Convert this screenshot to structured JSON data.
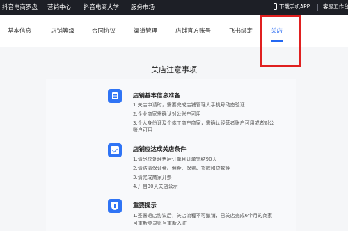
{
  "topbar": {
    "nav": [
      "抖音电商罗盘",
      "营销中心",
      "抖音电商大学",
      "服务市场"
    ],
    "download_app": "下载手机APP",
    "service_center": "客服工作台"
  },
  "tabs": [
    {
      "label": "基本信息",
      "active": false
    },
    {
      "label": "店铺等级",
      "active": false
    },
    {
      "label": "合同协议",
      "active": false
    },
    {
      "label": "渠道管理",
      "active": false
    },
    {
      "label": "店铺官方账号",
      "active": false
    },
    {
      "label": "飞书绑定",
      "active": false
    },
    {
      "label": "关店",
      "active": true
    }
  ],
  "page_title": "关店注意事项",
  "sections": [
    {
      "icon": "document-icon",
      "title": "店铺基本信息准备",
      "lines": [
        "1.关店申请时，需要完成店铺管理人手机号动态验证",
        "2.企业商家需确认对公账户可用",
        "3.个人身份证及个体工商户商家，需确认经营者账户可用或者对公",
        "账户可用"
      ]
    },
    {
      "icon": "checkbox-icon",
      "title": "店铺应达成关店条件",
      "lines": [
        "1.请尽快处理售后订单且订单完结90天",
        "2.请结清保证金、佣金、保费、货款和贷款等",
        "3.请完成商家开票",
        "4.开启30天关店公示"
      ]
    },
    {
      "icon": "shield-warning-icon",
      "title": "重要提示",
      "lines": [
        "1.签署退店协议后，关店流程不可撤销，已关店完成6个月的商家",
        "可重新登录账号重新入驻"
      ]
    }
  ],
  "colors": {
    "topbar_bg": "#1d1f26",
    "accent": "#2468f2",
    "highlight_box": "#e02020"
  }
}
